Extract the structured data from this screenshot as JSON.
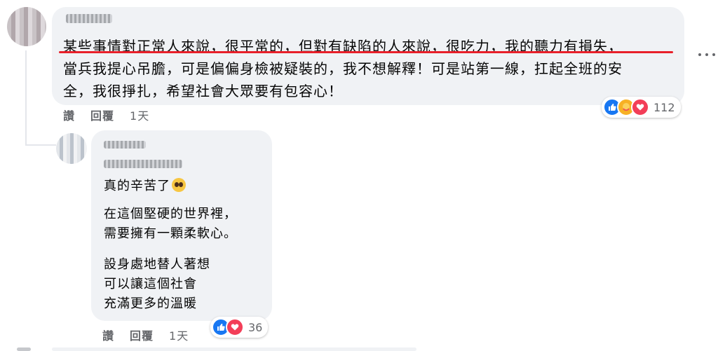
{
  "comment": {
    "text": "某些事情對正常人來說，很平常的，但對有缺陷的人來說，很吃力，我的聽力有損失，\n當兵我提心吊膽，可是偏偏身檢被疑裝的，我不想解釋！可是站第一線，扛起全班的安\n全，我很掙扎，希望社會大眾要有包容心！",
    "actions": {
      "like": "讚",
      "reply": "回覆",
      "time": "1天"
    },
    "reaction_count": "112",
    "reactions": [
      "like-icon",
      "care-icon",
      "love-icon"
    ],
    "underline_color": "#e8202a"
  },
  "reply": {
    "line1": "真的辛苦了",
    "para2": "在這個堅硬的世界裡，\n需要擁有一顆柔軟心。",
    "para3": "設身處地替人著想\n可以讓這個社會\n充滿更多的溫暖",
    "actions": {
      "like": "讚",
      "reply": "回覆",
      "time": "1天"
    },
    "reaction_count": "36",
    "reactions": [
      "like-icon",
      "love-icon"
    ]
  },
  "colors": {
    "bubble": "#f0f2f5",
    "meta": "#65676b",
    "like": "#1877f2",
    "love": "#f33e58",
    "care": "#f7b125"
  }
}
